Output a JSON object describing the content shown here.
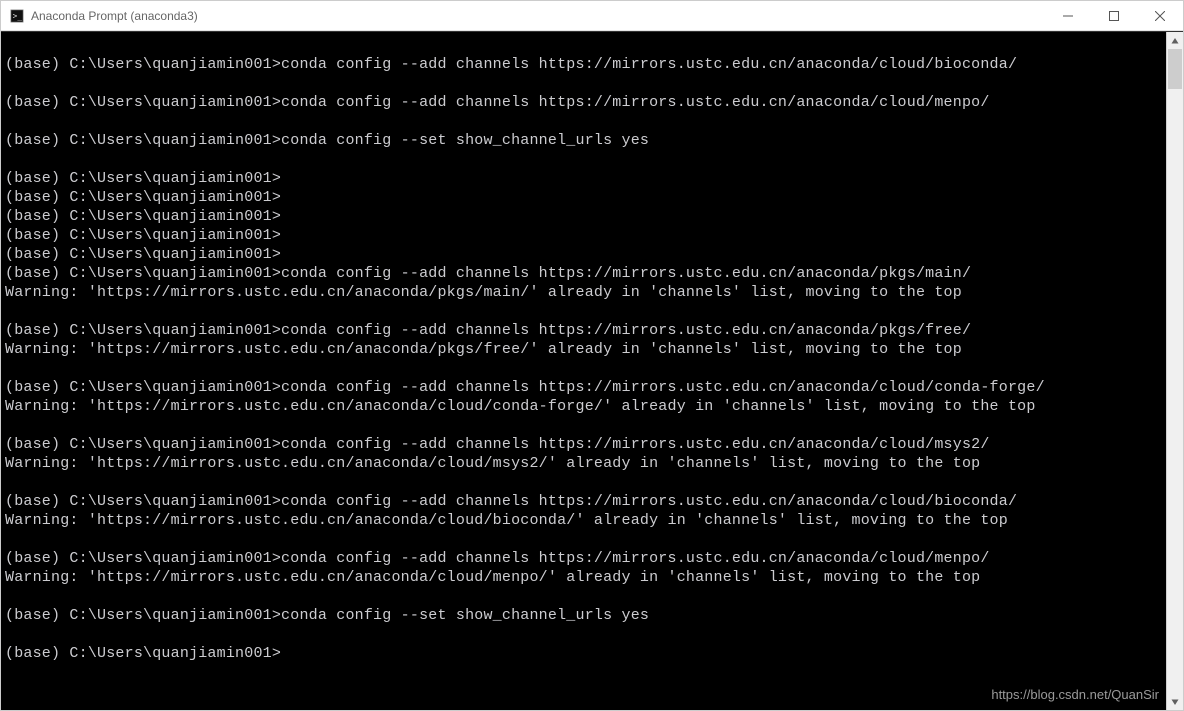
{
  "titlebar": {
    "title": "Anaconda Prompt (anaconda3)"
  },
  "terminal": {
    "lines": [
      "",
      "(base) C:\\Users\\quanjiamin001>conda config --add channels https://mirrors.ustc.edu.cn/anaconda/cloud/bioconda/",
      "",
      "(base) C:\\Users\\quanjiamin001>conda config --add channels https://mirrors.ustc.edu.cn/anaconda/cloud/menpo/",
      "",
      "(base) C:\\Users\\quanjiamin001>conda config --set show_channel_urls yes",
      "",
      "(base) C:\\Users\\quanjiamin001>",
      "(base) C:\\Users\\quanjiamin001>",
      "(base) C:\\Users\\quanjiamin001>",
      "(base) C:\\Users\\quanjiamin001>",
      "(base) C:\\Users\\quanjiamin001>",
      "(base) C:\\Users\\quanjiamin001>conda config --add channels https://mirrors.ustc.edu.cn/anaconda/pkgs/main/",
      "Warning: 'https://mirrors.ustc.edu.cn/anaconda/pkgs/main/' already in 'channels' list, moving to the top",
      "",
      "(base) C:\\Users\\quanjiamin001>conda config --add channels https://mirrors.ustc.edu.cn/anaconda/pkgs/free/",
      "Warning: 'https://mirrors.ustc.edu.cn/anaconda/pkgs/free/' already in 'channels' list, moving to the top",
      "",
      "(base) C:\\Users\\quanjiamin001>conda config --add channels https://mirrors.ustc.edu.cn/anaconda/cloud/conda-forge/",
      "Warning: 'https://mirrors.ustc.edu.cn/anaconda/cloud/conda-forge/' already in 'channels' list, moving to the top",
      "",
      "(base) C:\\Users\\quanjiamin001>conda config --add channels https://mirrors.ustc.edu.cn/anaconda/cloud/msys2/",
      "Warning: 'https://mirrors.ustc.edu.cn/anaconda/cloud/msys2/' already in 'channels' list, moving to the top",
      "",
      "(base) C:\\Users\\quanjiamin001>conda config --add channels https://mirrors.ustc.edu.cn/anaconda/cloud/bioconda/",
      "Warning: 'https://mirrors.ustc.edu.cn/anaconda/cloud/bioconda/' already in 'channels' list, moving to the top",
      "",
      "(base) C:\\Users\\quanjiamin001>conda config --add channels https://mirrors.ustc.edu.cn/anaconda/cloud/menpo/",
      "Warning: 'https://mirrors.ustc.edu.cn/anaconda/cloud/menpo/' already in 'channels' list, moving to the top",
      "",
      "(base) C:\\Users\\quanjiamin001>conda config --set show_channel_urls yes",
      "",
      "(base) C:\\Users\\quanjiamin001>"
    ]
  },
  "watermark": "https://blog.csdn.net/QuanSir"
}
